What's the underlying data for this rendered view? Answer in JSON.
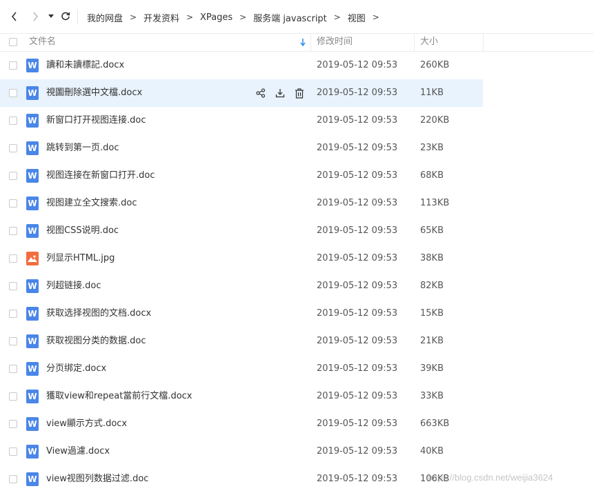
{
  "toolbar": {
    "breadcrumb": [
      "我的网盘",
      "开发资料",
      "XPages",
      "服务端 javascript",
      "视图"
    ],
    "separator": ">"
  },
  "columns": {
    "name": "文件名",
    "modified": "修改时间",
    "size": "大小"
  },
  "files": [
    {
      "name": "讀和未讀標記.docx",
      "modified": "2019-05-12 09:53",
      "size": "260KB",
      "type": "word",
      "icon": "W"
    },
    {
      "name": "視圖刪除選中文檔.docx",
      "modified": "2019-05-12 09:53",
      "size": "11KB",
      "type": "word",
      "icon": "W"
    },
    {
      "name": "新窗口打开视图连接.doc",
      "modified": "2019-05-12 09:53",
      "size": "220KB",
      "type": "word",
      "icon": "W"
    },
    {
      "name": "跳转到第一页.doc",
      "modified": "2019-05-12 09:53",
      "size": "23KB",
      "type": "word",
      "icon": "W"
    },
    {
      "name": "视图连接在新窗口打开.doc",
      "modified": "2019-05-12 09:53",
      "size": "68KB",
      "type": "word",
      "icon": "W"
    },
    {
      "name": "视图建立全文搜索.doc",
      "modified": "2019-05-12 09:53",
      "size": "113KB",
      "type": "word",
      "icon": "W"
    },
    {
      "name": "视图CSS说明.doc",
      "modified": "2019-05-12 09:53",
      "size": "65KB",
      "type": "word",
      "icon": "W"
    },
    {
      "name": "列显示HTML.jpg",
      "modified": "2019-05-12 09:53",
      "size": "38KB",
      "type": "image",
      "icon": ""
    },
    {
      "name": "列超链接.doc",
      "modified": "2019-05-12 09:53",
      "size": "82KB",
      "type": "word",
      "icon": "W"
    },
    {
      "name": "获取选择视图的文档.docx",
      "modified": "2019-05-12 09:53",
      "size": "15KB",
      "type": "word",
      "icon": "W"
    },
    {
      "name": "获取视图分类的数据.doc",
      "modified": "2019-05-12 09:53",
      "size": "21KB",
      "type": "word",
      "icon": "W"
    },
    {
      "name": "分页绑定.docx",
      "modified": "2019-05-12 09:53",
      "size": "39KB",
      "type": "word",
      "icon": "W"
    },
    {
      "name": "獲取view和repeat當前行文檔.docx",
      "modified": "2019-05-12 09:53",
      "size": "33KB",
      "type": "word",
      "icon": "W"
    },
    {
      "name": "view顯示方式.docx",
      "modified": "2019-05-12 09:53",
      "size": "663KB",
      "type": "word",
      "icon": "W"
    },
    {
      "name": "View過濾.docx",
      "modified": "2019-05-12 09:53",
      "size": "40KB",
      "type": "word",
      "icon": "W"
    },
    {
      "name": "view视图列数据过滤.doc",
      "modified": "2019-05-12 09:53",
      "size": "106KB",
      "type": "word",
      "icon": "W"
    }
  ],
  "hovered_row": 1,
  "watermark": "https://blog.csdn.net/weijia3624",
  "colors": {
    "accent": "#2b91e6",
    "hover_row": "#e8f3fd",
    "word_icon": "#4a86e8",
    "image_icon": "#f26d3d"
  }
}
